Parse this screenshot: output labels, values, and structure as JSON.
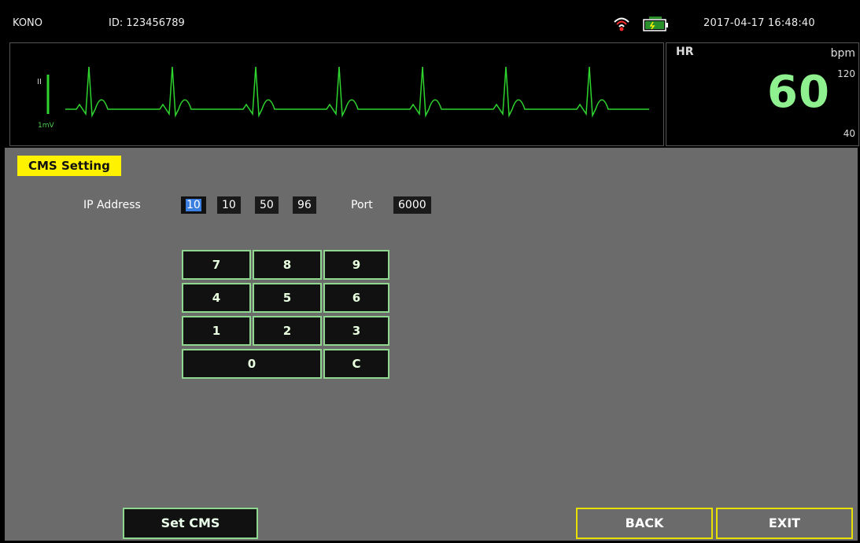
{
  "topbar": {
    "brand": "KONO",
    "patient_id": "ID: 123456789",
    "datetime": "2017-04-17  16:48:40",
    "icons": [
      "wifi-icon",
      "battery-icon"
    ]
  },
  "ecg": {
    "lead": "II",
    "scale": "1mV",
    "color": "#2fd42f"
  },
  "hr": {
    "label": "HR",
    "unit": "bpm",
    "value": "60",
    "high_limit": "120",
    "low_limit": "40",
    "value_color": "#8ef08e"
  },
  "cms": {
    "title": "CMS Setting",
    "ip_label": "IP Address",
    "ip": [
      "10",
      "10",
      "50",
      "96"
    ],
    "port_label": "Port",
    "port": "6000"
  },
  "keypad": [
    "7",
    "8",
    "9",
    "4",
    "5",
    "6",
    "1",
    "2",
    "3",
    "0",
    "C"
  ],
  "buttons": {
    "set_cms": "Set CMS",
    "back": "BACK",
    "exit": "EXIT"
  },
  "colors": {
    "highlight": "#fff200",
    "selection": "#3b7fe0",
    "panel": "#6b6b6b",
    "key_border": "#8fd68f"
  }
}
